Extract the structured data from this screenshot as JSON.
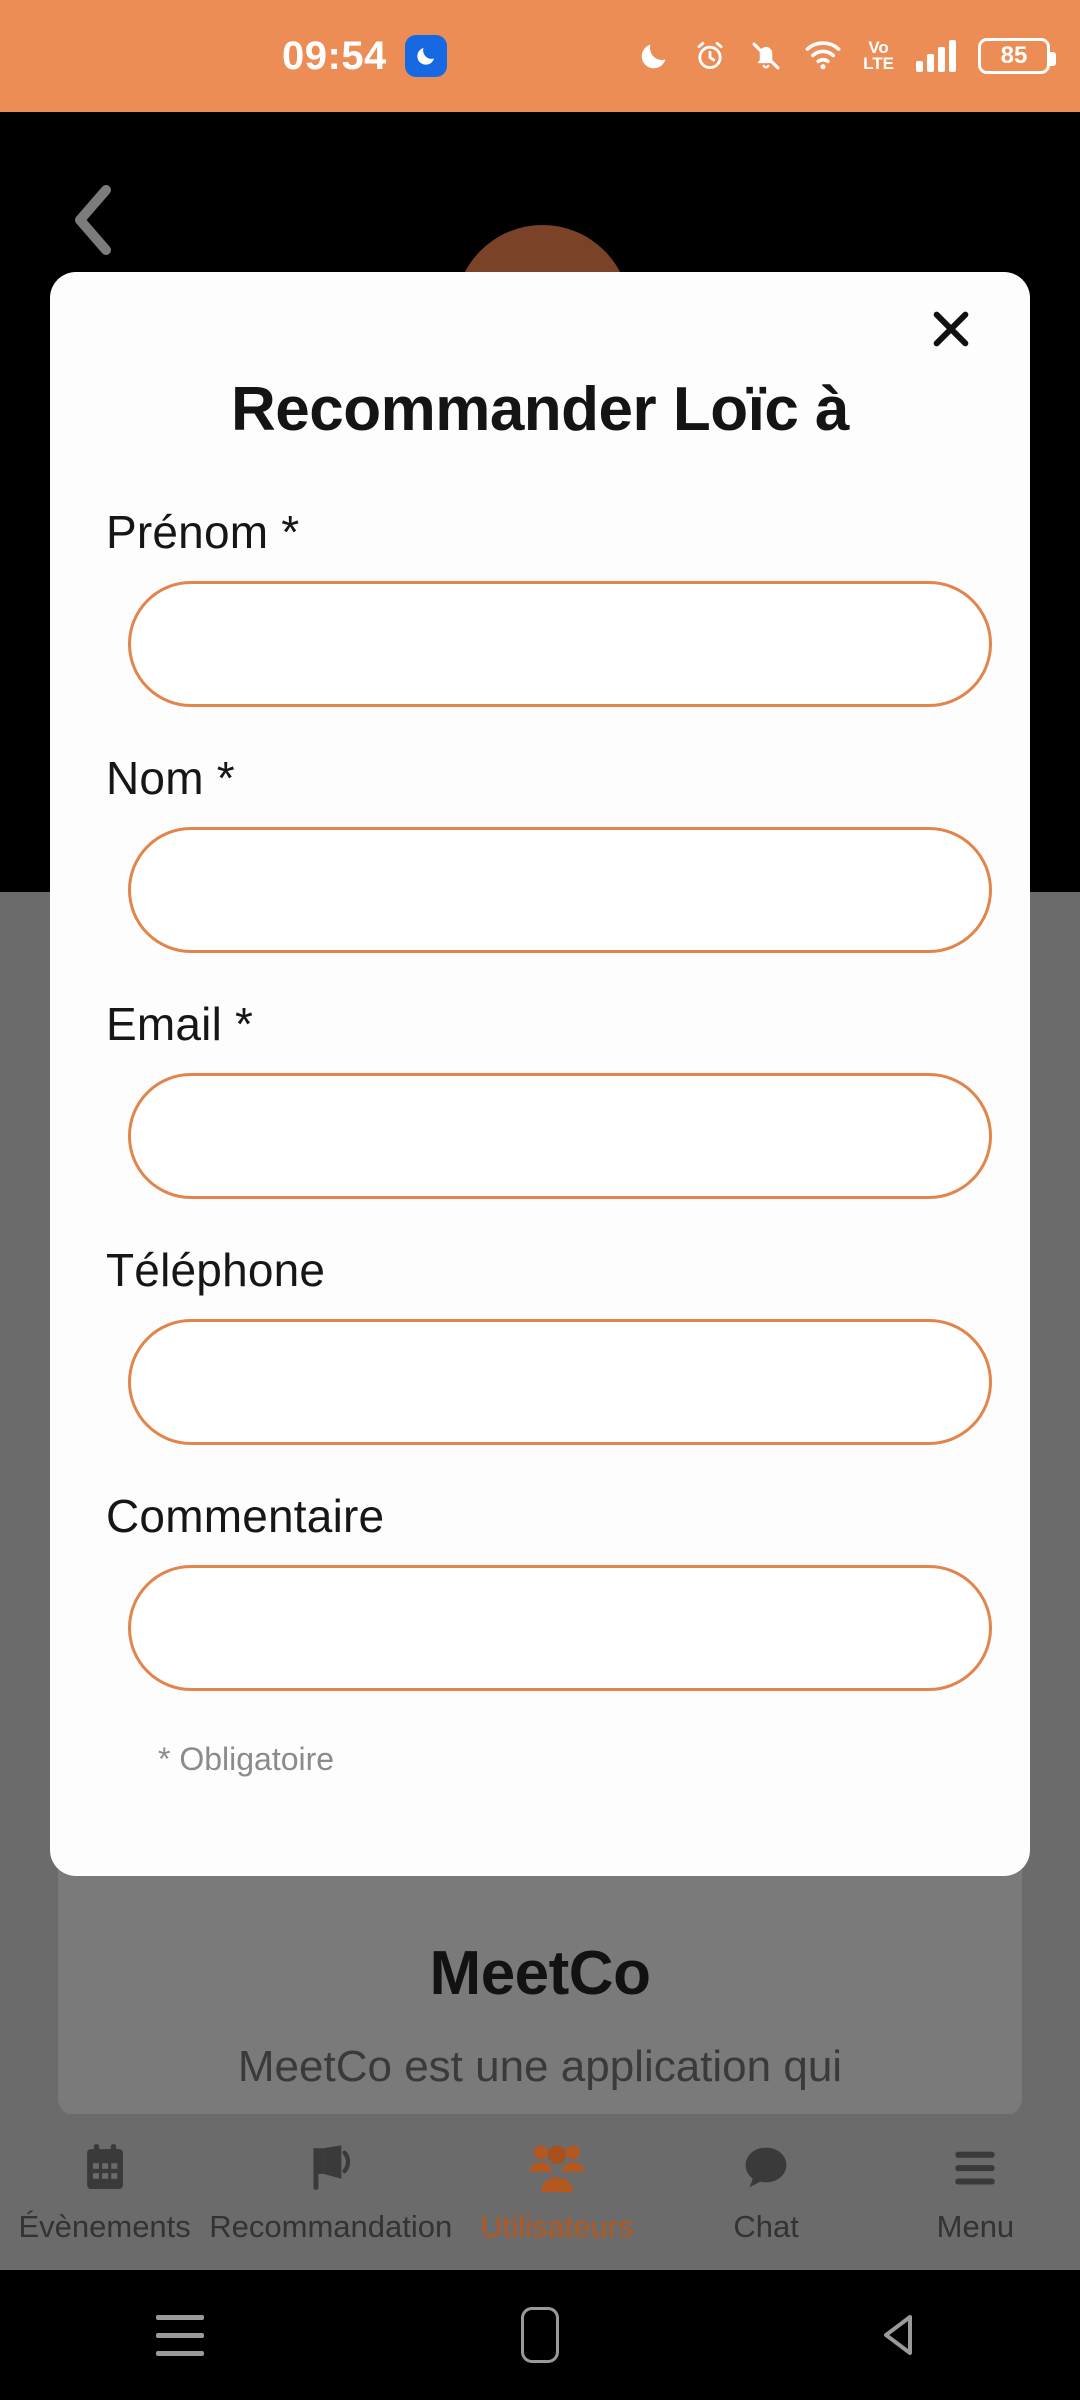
{
  "status_bar": {
    "time": "09:54",
    "dnd_badge_icon": "moon-icon",
    "icons": [
      {
        "name": "moon-icon",
        "label": "Do not disturb"
      },
      {
        "name": "alarm-clock-icon",
        "label": "Alarm set"
      },
      {
        "name": "bell-muted-icon",
        "label": "Silent mode"
      },
      {
        "name": "wifi-icon",
        "label": "Wi-Fi connected"
      },
      {
        "name": "volte-icon",
        "label": "VoLTE"
      },
      {
        "name": "signal-bars-icon",
        "label": "Cellular signal"
      },
      {
        "name": "battery-icon",
        "label": "Battery"
      }
    ],
    "volte_top": "Vo",
    "volte_bottom": "LTE",
    "battery_percent": "85",
    "accent_color": "#ED8D56"
  },
  "app": {
    "back_icon": "chevron-left-icon",
    "avatar_icon": "user-avatar",
    "content_title": "MeetCo",
    "content_subtitle": "MeetCo est une application qui"
  },
  "modal": {
    "title": "Recommander Loïc à",
    "close_icon": "close-icon",
    "required_note": "* Obligatoire",
    "fields": [
      {
        "label": "Prénom *",
        "value": "",
        "placeholder": "",
        "name": "prenom-input"
      },
      {
        "label": "Nom *",
        "value": "",
        "placeholder": "",
        "name": "nom-input"
      },
      {
        "label": "Email *",
        "value": "",
        "placeholder": "",
        "name": "email-input"
      },
      {
        "label": "Téléphone",
        "value": "",
        "placeholder": "",
        "name": "telephone-input"
      },
      {
        "label": "Commentaire",
        "value": "",
        "placeholder": "",
        "name": "commentaire-input"
      }
    ],
    "border_color": "#E2854D"
  },
  "tabbar": {
    "active_color": "#B4581F",
    "inactive_color": "#333333",
    "items": [
      {
        "label": "Évènements",
        "icon": "calendar-icon",
        "active": false
      },
      {
        "label": "Recommandation",
        "icon": "megaphone-icon",
        "active": false
      },
      {
        "label": "Utilisateurs",
        "icon": "users-icon",
        "active": true
      },
      {
        "label": "Chat",
        "icon": "chat-bubble-icon",
        "active": false
      },
      {
        "label": "Menu",
        "icon": "hamburger-menu-icon",
        "active": false
      }
    ]
  },
  "android_nav": {
    "recents_icon": "recents-icon",
    "home_icon": "home-icon",
    "back_icon": "back-triangle-icon"
  }
}
